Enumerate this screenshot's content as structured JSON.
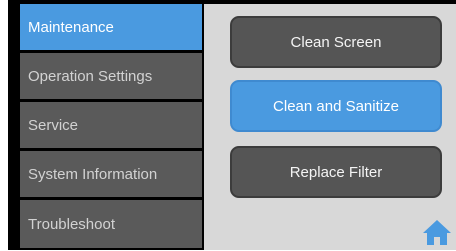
{
  "sidebar": {
    "items": [
      {
        "label": "Maintenance",
        "active": true
      },
      {
        "label": "Operation Settings",
        "active": false
      },
      {
        "label": "Service",
        "active": false
      },
      {
        "label": "System Information",
        "active": false
      },
      {
        "label": "Troubleshoot",
        "active": false
      }
    ]
  },
  "main": {
    "buttons": [
      {
        "label": "Clean Screen",
        "selected": false
      },
      {
        "label": "Clean and Sanitize",
        "selected": true
      },
      {
        "label": "Replace Filter",
        "selected": false
      }
    ],
    "home_icon": "home-icon"
  },
  "colors": {
    "accent": "#4a9ae0",
    "button": "#555555",
    "sidebar_item": "#5a5a5a",
    "panel": "#d8d8d8"
  }
}
